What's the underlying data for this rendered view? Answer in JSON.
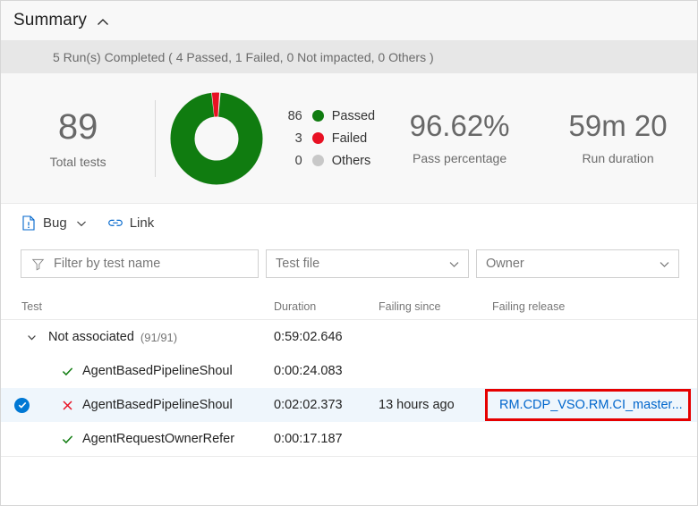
{
  "summary": {
    "title": "Summary",
    "collapse_icon": "chevron-up-icon",
    "run_banner": "5 Run(s) Completed ( 4 Passed, 1 Failed, 0 Not impacted, 0 Others )"
  },
  "stats": {
    "total": {
      "value": "89",
      "label": "Total tests"
    },
    "pass_percentage": {
      "value": "96.62%",
      "label": "Pass percentage"
    },
    "run_duration": {
      "value": "59m 20",
      "label": "Run duration"
    }
  },
  "chart_data": {
    "type": "pie",
    "title": "Test outcome distribution",
    "categories": [
      "Passed",
      "Failed",
      "Others"
    ],
    "values": [
      86,
      3,
      0
    ],
    "colors": [
      "#107c10",
      "#e81123",
      "#c8c8c8"
    ],
    "total": 89,
    "donut": true,
    "legend_position": "right",
    "legend": [
      {
        "count": "86",
        "label": "Passed",
        "color": "#107c10"
      },
      {
        "count": "3",
        "label": "Failed",
        "color": "#e81123"
      },
      {
        "count": "0",
        "label": "Others",
        "color": "#c8c8c8"
      }
    ]
  },
  "toolbar": {
    "bug_label": "Bug",
    "bug_icon": "bug-file-icon",
    "bug_caret": "chevron-down-icon",
    "link_label": "Link",
    "link_icon": "chain-link-icon"
  },
  "filters": {
    "test_name": {
      "placeholder": "Filter by test name",
      "value": "",
      "icon": "funnel-icon"
    },
    "test_file": {
      "label": "Test file",
      "value": "",
      "caret": "chevron-down-icon"
    },
    "owner": {
      "label": "Owner",
      "value": "",
      "caret": "chevron-down-icon"
    }
  },
  "table": {
    "columns": {
      "test": "Test",
      "duration": "Duration",
      "failing_since": "Failing since",
      "failing_release": "Failing release"
    },
    "rows": [
      {
        "type": "group",
        "expand_icon": "chevron-down-icon",
        "name": "Not associated",
        "count": "(91/91)",
        "duration": "0:59:02.646",
        "failing_since": "",
        "failing_release": ""
      },
      {
        "type": "test",
        "status": "passed",
        "status_icon": "check-icon",
        "name": "AgentBasedPipelineShoul",
        "duration": "0:00:24.083",
        "failing_since": "",
        "failing_release": ""
      },
      {
        "type": "test",
        "status": "failed",
        "status_icon": "x-icon",
        "selected": true,
        "select_icon": "check-circle-icon",
        "name": "AgentBasedPipelineShoul",
        "duration": "0:02:02.373",
        "failing_since": "13 hours ago",
        "failing_release": "RM.CDP_VSO.RM.CI_master..."
      },
      {
        "type": "test",
        "status": "passed",
        "status_icon": "check-icon",
        "name": "AgentRequestOwnerRefer",
        "duration": "0:00:17.187",
        "failing_since": "",
        "failing_release": ""
      }
    ]
  },
  "colors": {
    "passed": "#107c10",
    "failed": "#e81123",
    "others": "#c8c8c8",
    "link": "#0066cc",
    "accent": "#0078d4",
    "annotation": "#e60000"
  }
}
